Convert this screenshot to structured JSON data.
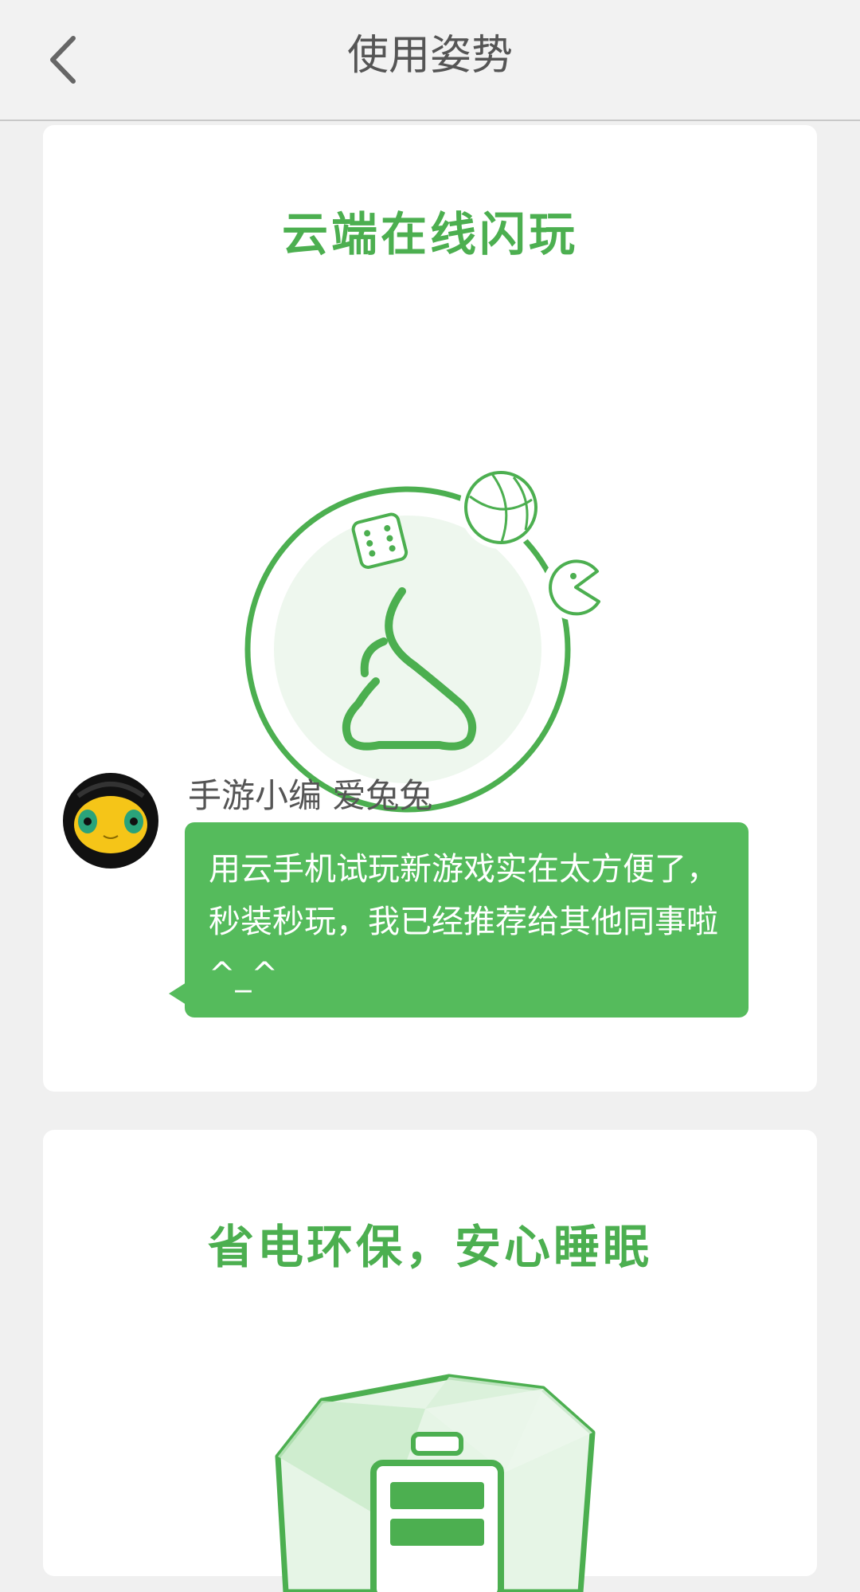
{
  "header": {
    "title": "使用姿势",
    "back_icon": "chevron-left-icon"
  },
  "colors": {
    "accent": "#4caf50",
    "bubble": "#55bb5c",
    "background": "#f0f0f0",
    "header_text": "#555555"
  },
  "cards": [
    {
      "title": "云端在线闪玩",
      "illustration": "cloud-gamepad-icon",
      "testimonial": {
        "author": "手游小编 爱兔兔",
        "avatar": "avatar-icon",
        "message": "用云手机试玩新游戏实在太方便了，秒装秒玩，我已经推荐给其他同事啦^_^"
      }
    },
    {
      "title": "省电环保，安心睡眠",
      "illustration": "battery-gem-icon"
    }
  ]
}
